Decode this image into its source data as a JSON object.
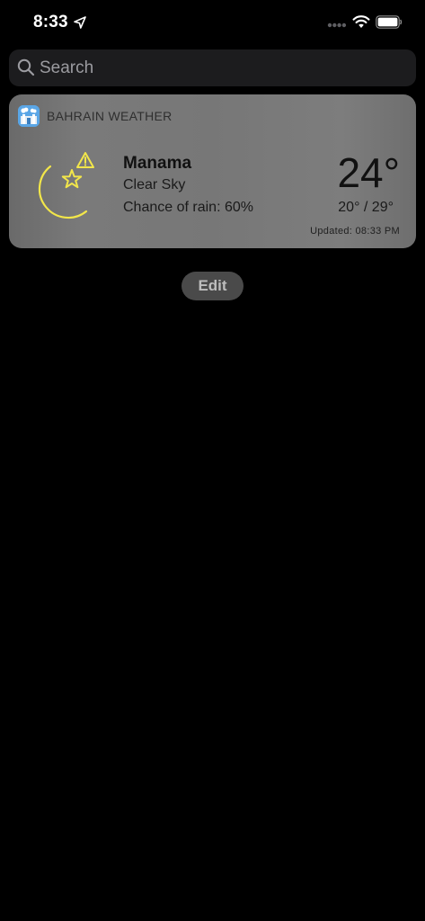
{
  "status_bar": {
    "time": "8:33",
    "icons": [
      "location-arrow-icon",
      "cellular-signal-icon",
      "wifi-icon",
      "battery-icon"
    ]
  },
  "search": {
    "placeholder": "Search",
    "icon": "search-icon"
  },
  "widget": {
    "app_name": "BAHRAIN WEATHER",
    "city": "Manama",
    "condition": "Clear Sky",
    "rain": "Chance of rain: 60%",
    "temperature": "24°",
    "range": "20° / 29°",
    "updated": "Updated: 08:33 PM",
    "weather_icon": "moon-star-warning-icon",
    "accent_color": "#f2e64a"
  },
  "edit_button": {
    "label": "Edit"
  }
}
